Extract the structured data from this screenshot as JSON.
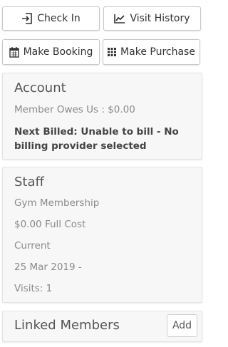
{
  "actions": {
    "check_in": "Check In",
    "visit_history": "Visit History",
    "make_booking": "Make Booking",
    "make_purchase": "Make Purchase",
    "icons": [
      "door-enter-icon",
      "line-chart-icon",
      "calendar-icon",
      "grid-icon"
    ]
  },
  "account": {
    "title": "Account",
    "owes": "Member Owes Us : $0.00",
    "next_billed": "Next Billed: Unable to bill - No billing provider selected"
  },
  "staff": {
    "title": "Staff",
    "membership": "Gym Membership",
    "cost": "$0.00 Full Cost",
    "status": "Current",
    "start_date": "25 Mar 2019 -",
    "visits": "Visits: 1"
  },
  "linked": {
    "title": "Linked Members",
    "add_label": "Add"
  },
  "colors": {
    "card_bg": "#f7f7f7",
    "muted_text": "#8a8a8a"
  }
}
